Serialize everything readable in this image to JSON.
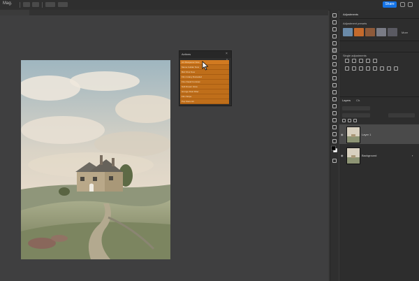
{
  "options_bar": {
    "tool_label": "Mag.",
    "share_label": "Share"
  },
  "actions_panel": {
    "title": "Actions",
    "close_glyph": "×",
    "menu_glyph": "≡",
    "items": [
      "Art Sharpener Now",
      "Meme builder Now",
      "Bird Shot Now",
      "Film Grainy Reloaded",
      "Fine Detail Contrast",
      "Soft Dream Glow",
      "Grunge Rust Filter",
      "Film Stripe",
      "Pop Stars Hit"
    ],
    "selected_index": 0
  },
  "panels": {
    "adjustments_title": "Adjustments",
    "adjustment_presets_label": "Adjustment presets",
    "more_label": "More",
    "single_adjustments_label": "Single adjustments",
    "layers_tab": "Layers",
    "channels_tab": "Ch.",
    "layers": [
      {
        "name": "Layer 1",
        "selected": true
      },
      {
        "name": "Background",
        "selected": false
      }
    ]
  },
  "colors": {
    "actions_bg": "#bf6e1a",
    "canvas_bg": "#3f3f40",
    "accent": "#1473e6"
  }
}
